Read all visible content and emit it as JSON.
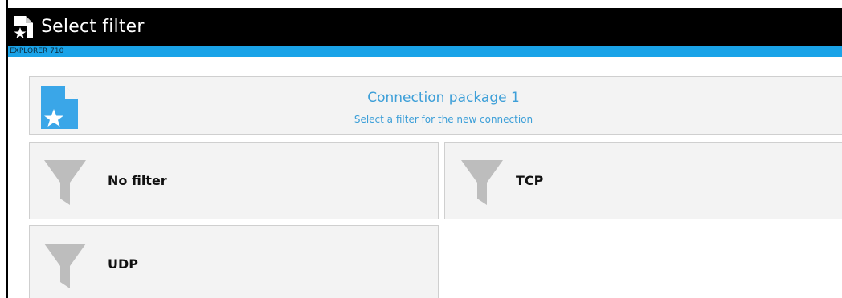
{
  "window": {
    "title": "Select filter",
    "device": "EXPLORER 710"
  },
  "header": {
    "title": "Connection package 1",
    "subtitle": "Select a filter for the new connection"
  },
  "filters": [
    {
      "label": "No filter"
    },
    {
      "label": "TCP"
    },
    {
      "label": "UDP"
    }
  ],
  "colors": {
    "titlebar": "#000000",
    "accent_bar": "#1aa3e8",
    "header_text": "#3d9fd8",
    "tile_bg": "#f3f3f3",
    "funnel": "#bdbdbd"
  },
  "icons": {
    "app": "document-star-icon",
    "package": "document-star-icon",
    "filter": "funnel-icon"
  }
}
